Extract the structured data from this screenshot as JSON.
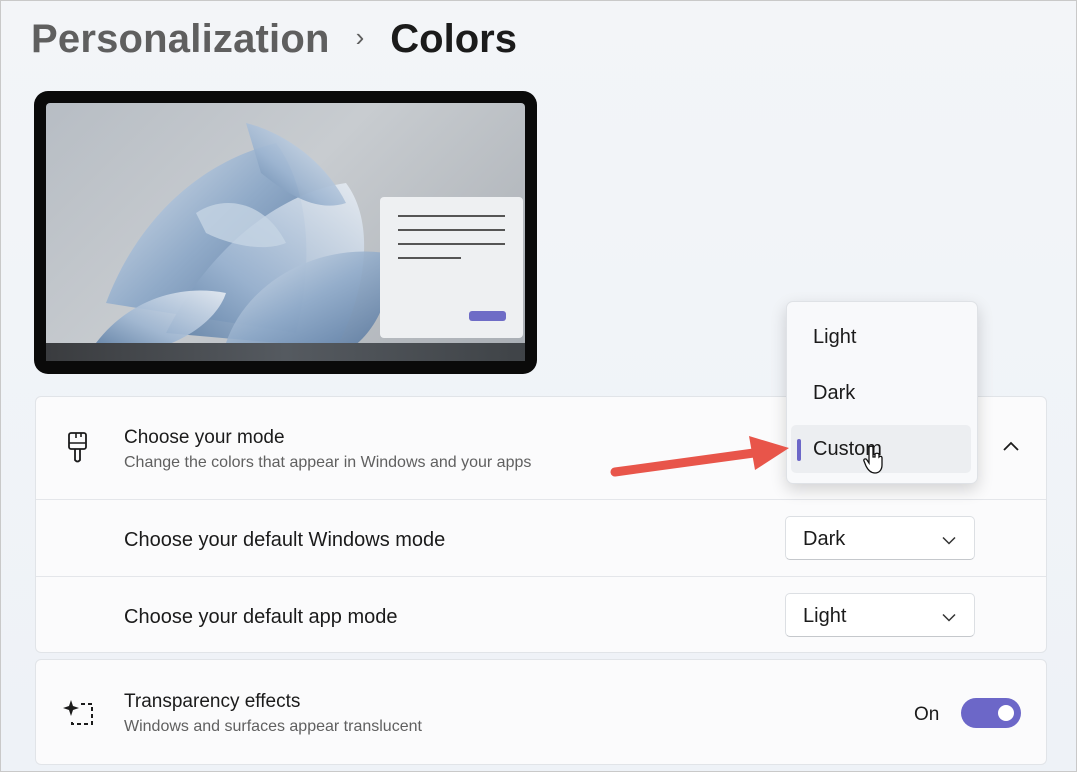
{
  "breadcrumb": {
    "parent": "Personalization",
    "separator": "›",
    "current": "Colors"
  },
  "mode_section": {
    "icon": "paintbrush-icon",
    "title": "Choose your mode",
    "subtitle": "Change the colors that appear in Windows and your apps",
    "expanded": true,
    "dropdown_options": [
      {
        "label": "Light",
        "selected": false
      },
      {
        "label": "Dark",
        "selected": false
      },
      {
        "label": "Custom",
        "selected": true
      }
    ],
    "windows_mode": {
      "label": "Choose your default Windows mode",
      "value": "Dark"
    },
    "app_mode": {
      "label": "Choose your default app mode",
      "value": "Light"
    }
  },
  "transparency": {
    "icon": "transparency-sparkle-icon",
    "title": "Transparency effects",
    "subtitle": "Windows and surfaces appear translucent",
    "state_label": "On",
    "enabled": true
  },
  "colors": {
    "accent": "#6c67c8",
    "annotation_arrow": "#e8554a"
  }
}
